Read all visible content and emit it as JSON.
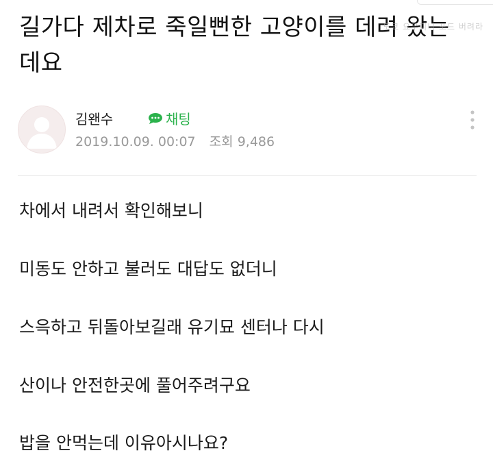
{
  "post": {
    "title": "길가다 제차로 죽일뻔한 고양이를 데려 왔는데요",
    "watermark": "도쿄 요우디니 포드 버려라"
  },
  "author": {
    "name": "김왠수",
    "chat_label": "채팅",
    "date": "2019.10.09. 00:07",
    "views_label": "조회",
    "views": "9,486"
  },
  "body": {
    "lines": [
      "차에서 내려서 확인해보니",
      "미동도 안하고 불러도 대답도 없더니",
      "스윽하고 뒤돌아보길래 유기묘 센터나 다시",
      "산이나 안전한곳에 풀어주려구요",
      "밥을 안먹는데 이유아시나요?"
    ]
  },
  "icons": {
    "chat": "chat-bubble-icon",
    "more": "more-vertical-icon",
    "avatar": "default-avatar-icon"
  },
  "colors": {
    "accent": "#2bb24c",
    "meta_text": "#9a9a9a",
    "avatar_bg": "#f5eded"
  }
}
